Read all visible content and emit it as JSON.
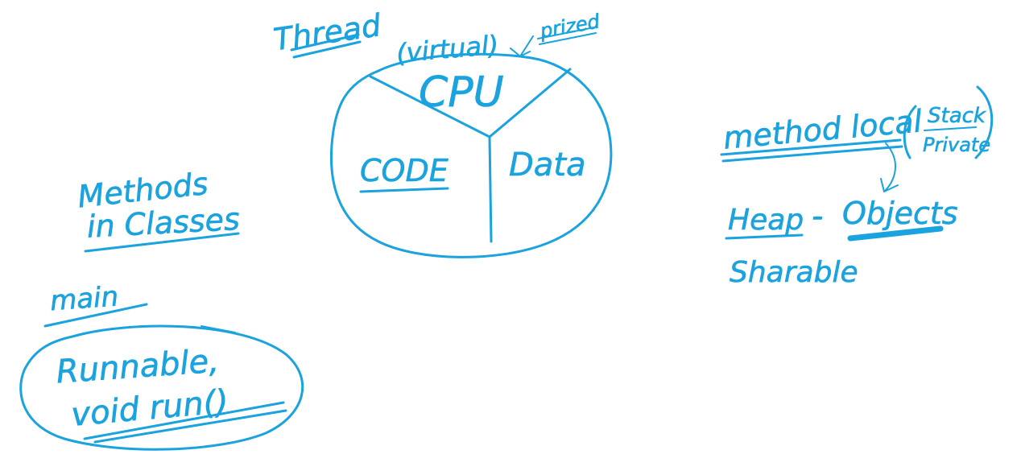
{
  "canvas": {
    "ink_color": "#1aa3df",
    "background": "#ffffff"
  },
  "cpu_diagram": {
    "title": "Thread",
    "virtual_note": "(virtual)",
    "pointer_note": "prized",
    "segments": {
      "top": "CPU",
      "left": "CODE",
      "right": "Data"
    }
  },
  "methods_note": {
    "line1": "Methods",
    "line2": "in Classes"
  },
  "main_note": {
    "label": "main",
    "line1": "Runnable,",
    "line2": "void run()"
  },
  "memory_note": {
    "method_local": "method local",
    "stack_private_1": "Stack",
    "stack_private_2": "Private",
    "heap": "Heap",
    "dash": "-",
    "objects": "Objects",
    "sharable": "Sharable"
  }
}
